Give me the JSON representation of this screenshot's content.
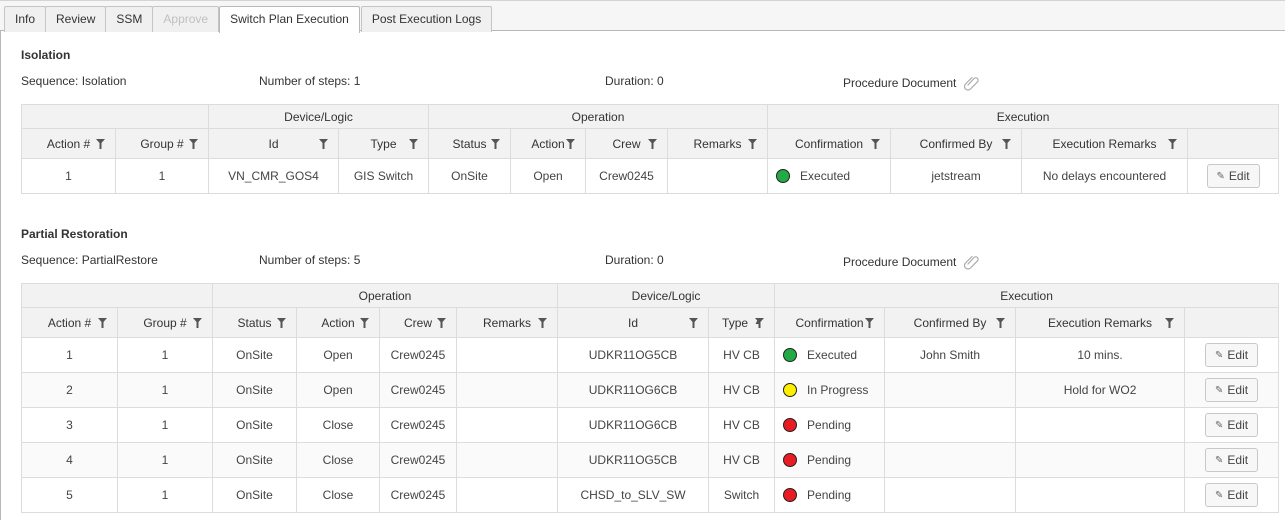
{
  "tabs": [
    {
      "label": "Info",
      "state": "normal"
    },
    {
      "label": "Review",
      "state": "normal"
    },
    {
      "label": "SSM",
      "state": "normal"
    },
    {
      "label": "Approve",
      "state": "disabled"
    },
    {
      "label": "Switch Plan Execution",
      "state": "active"
    },
    {
      "label": "Post Execution Logs",
      "state": "normal"
    }
  ],
  "colors": {
    "executed": "#22aa44",
    "in_progress": "#ffee00",
    "pending": "#e81c24"
  },
  "isolation": {
    "title": "Isolation",
    "sequence": "Sequence: Isolation",
    "steps": "Number of steps: 1",
    "duration": "Duration: 0",
    "procedure_document": "Procedure Document",
    "groups": {
      "device": "Device/Logic",
      "operation": "Operation",
      "execution": "Execution"
    },
    "columns": {
      "action_no": "Action #",
      "group_no": "Group #",
      "id": "Id",
      "type": "Type",
      "status": "Status",
      "action": "Action",
      "crew": "Crew",
      "remarks": "Remarks",
      "confirmation": "Confirmation",
      "confirmed_by": "Confirmed By",
      "execution_remarks": "Execution Remarks"
    },
    "rows": [
      {
        "action_no": "1",
        "group_no": "1",
        "id": "VN_CMR_GOS4",
        "type": "GIS Switch",
        "status": "OnSite",
        "action": "Open",
        "crew": "Crew0245",
        "remarks": "",
        "confirmation": "Executed",
        "confirmation_state": "executed",
        "confirmed_by": "jetstream",
        "execution_remarks": "No delays encountered",
        "edit": "Edit"
      }
    ]
  },
  "partial": {
    "title": "Partial Restoration",
    "sequence": "Sequence: PartialRestore",
    "steps": "Number of steps: 5",
    "duration": "Duration: 0",
    "procedure_document": "Procedure Document",
    "groups": {
      "operation": "Operation",
      "device": "Device/Logic",
      "execution": "Execution"
    },
    "columns": {
      "action_no": "Action #",
      "group_no": "Group #",
      "status": "Status",
      "action": "Action",
      "crew": "Crew",
      "remarks": "Remarks",
      "id": "Id",
      "type": "Type",
      "confirmation": "Confirmation",
      "confirmed_by": "Confirmed By",
      "execution_remarks": "Execution Remarks"
    },
    "sorted_column": "type",
    "sort_direction": "ascending",
    "rows": [
      {
        "action_no": "1",
        "group_no": "1",
        "status": "OnSite",
        "action": "Open",
        "crew": "Crew0245",
        "remarks": "",
        "id": "UDKR11OG5CB",
        "type": "HV CB",
        "confirmation": "Executed",
        "confirmation_state": "executed",
        "confirmed_by": "John Smith",
        "execution_remarks": "10 mins.",
        "edit": "Edit"
      },
      {
        "action_no": "2",
        "group_no": "1",
        "status": "OnSite",
        "action": "Open",
        "crew": "Crew0245",
        "remarks": "",
        "id": "UDKR11OG6CB",
        "type": "HV CB",
        "confirmation": "In Progress",
        "confirmation_state": "in_progress",
        "confirmed_by": "",
        "execution_remarks": "Hold for WO2",
        "edit": "Edit"
      },
      {
        "action_no": "3",
        "group_no": "1",
        "status": "OnSite",
        "action": "Close",
        "crew": "Crew0245",
        "remarks": "",
        "id": "UDKR11OG6CB",
        "type": "HV CB",
        "confirmation": "Pending",
        "confirmation_state": "pending",
        "confirmed_by": "",
        "execution_remarks": "",
        "edit": "Edit"
      },
      {
        "action_no": "4",
        "group_no": "1",
        "status": "OnSite",
        "action": "Close",
        "crew": "Crew0245",
        "remarks": "",
        "id": "UDKR11OG5CB",
        "type": "HV CB",
        "confirmation": "Pending",
        "confirmation_state": "pending",
        "confirmed_by": "",
        "execution_remarks": "",
        "edit": "Edit"
      },
      {
        "action_no": "5",
        "group_no": "1",
        "status": "OnSite",
        "action": "Close",
        "crew": "Crew0245",
        "remarks": "",
        "id": "CHSD_to_SLV_SW",
        "type": "Switch",
        "confirmation": "Pending",
        "confirmation_state": "pending",
        "confirmed_by": "",
        "execution_remarks": "",
        "edit": "Edit"
      }
    ]
  }
}
